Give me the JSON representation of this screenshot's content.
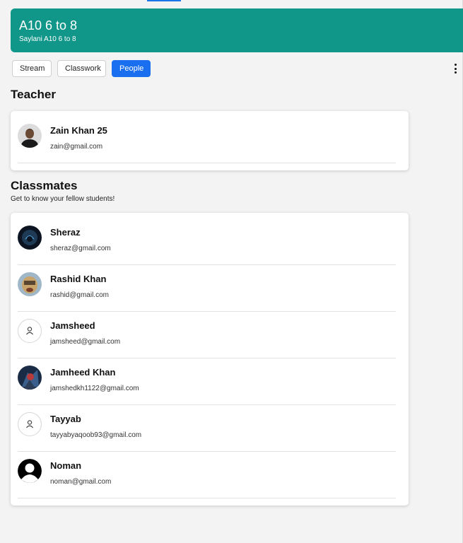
{
  "banner": {
    "title": "A10 6 to 8",
    "subtitle": "Saylani A10 6 to 8",
    "color": "#11968a"
  },
  "tabs": [
    {
      "label": "Stream",
      "active": false
    },
    {
      "label": "Classwork",
      "active": false
    },
    {
      "label": "People",
      "active": true
    }
  ],
  "more_menu_icon": "kebab-menu-icon",
  "teacher_section": {
    "heading": "Teacher",
    "people": [
      {
        "name": "Zain Khan 25",
        "email": "zain@gmail.com",
        "avatar": "photo"
      }
    ]
  },
  "classmates_section": {
    "heading": "Classmates",
    "subtitle": "Get to know your fellow students!",
    "people": [
      {
        "name": "Sheraz",
        "email": "sheraz@gmail.com",
        "avatar": "photo"
      },
      {
        "name": "Rashid Khan",
        "email": "rashid@gmail.com",
        "avatar": "photo"
      },
      {
        "name": "Jamsheed",
        "email": "jamsheed@gmail.com",
        "avatar": "person-icon"
      },
      {
        "name": "Jamheed Khan",
        "email": "jamshedkh1122@gmail.com",
        "avatar": "photo"
      },
      {
        "name": "Tayyab",
        "email": "tayyabyaqoob93@gmail.com",
        "avatar": "person-icon"
      },
      {
        "name": "Noman",
        "email": "noman@gmail.com",
        "avatar": "default-silhouette"
      }
    ]
  },
  "accent_color": "#1a6ff0"
}
